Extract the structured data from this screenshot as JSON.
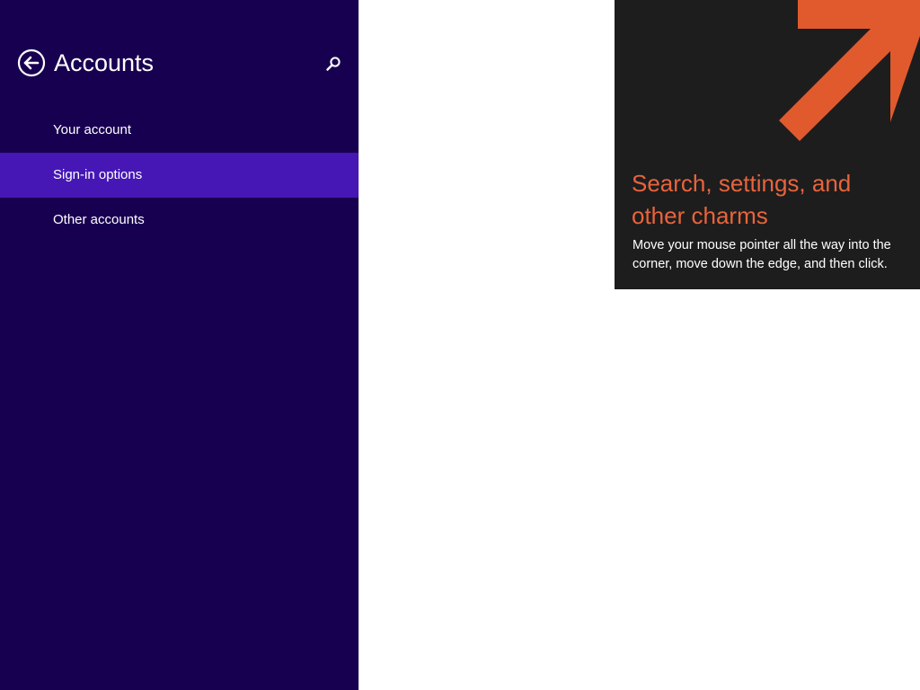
{
  "header": {
    "title": "Accounts",
    "back_icon": "back-arrow-circle-icon",
    "search_icon": "search-icon"
  },
  "nav": {
    "items": [
      {
        "label": "Your account",
        "selected": false
      },
      {
        "label": "Sign-in options",
        "selected": true
      },
      {
        "label": "Other accounts",
        "selected": false
      }
    ]
  },
  "tip": {
    "title_line1": "Search, settings, and",
    "title_line2": "other charms",
    "body_line1": "Move your mouse pointer all the way into the",
    "body_line2": "corner, move down the edge, and then click.",
    "arrow_icon": "arrow-up-right-icon"
  },
  "colors": {
    "sidebar_bg": "#180050",
    "selected_bg": "#4617b4",
    "tip_bg": "#1d1d1d",
    "tip_accent": "#e8643c"
  }
}
